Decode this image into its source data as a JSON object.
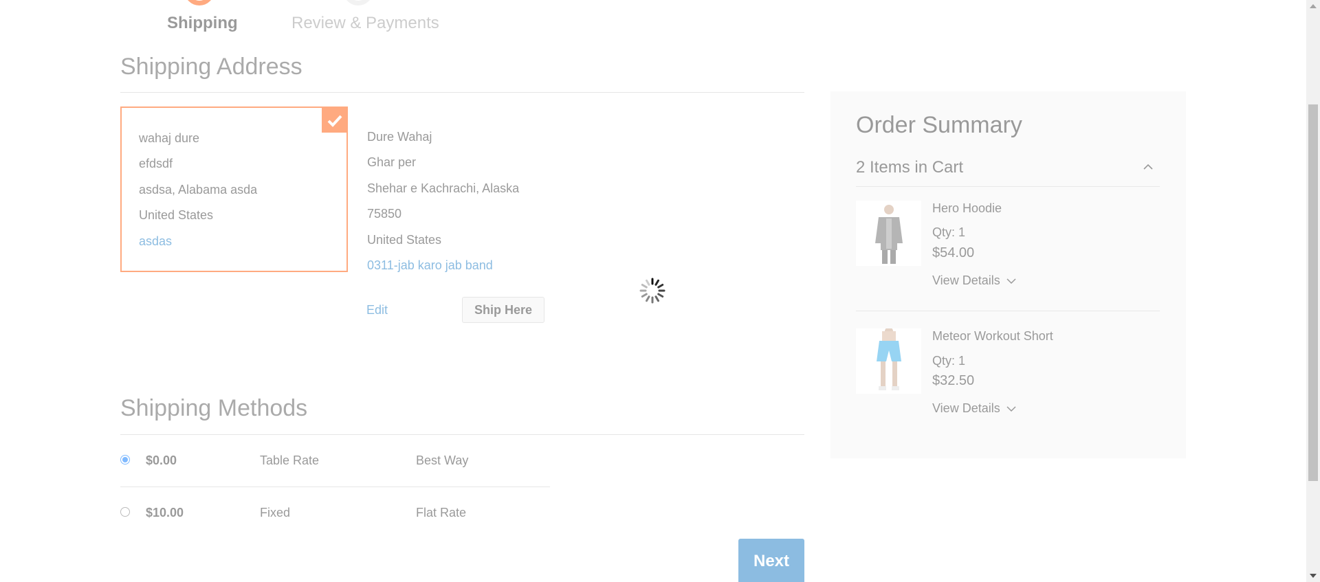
{
  "progress": {
    "steps": [
      {
        "label": "Shipping",
        "active": true
      },
      {
        "label": "Review & Payments",
        "active": false
      }
    ]
  },
  "shipping_address": {
    "title": "Shipping Address",
    "selected_address": {
      "lines": [
        "wahaj dure",
        "efdsdf",
        "asdsa, Alabama asda",
        "United States"
      ],
      "phone": "asdas"
    },
    "other_address": {
      "lines": [
        "Dure Wahaj",
        "Ghar per",
        "Shehar e Kachrachi, Alaska",
        "75850",
        "United States"
      ],
      "phone": "0311-jab karo jab band",
      "edit_label": "Edit",
      "ship_here_label": "Ship Here"
    }
  },
  "shipping_methods": {
    "title": "Shipping Methods",
    "rows": [
      {
        "price": "$0.00",
        "method": "Table Rate",
        "carrier": "Best Way",
        "selected": true
      },
      {
        "price": "$10.00",
        "method": "Fixed",
        "carrier": "Flat Rate",
        "selected": false
      }
    ],
    "next_label": "Next"
  },
  "order_summary": {
    "title": "Order Summary",
    "cart_count": "2 Items in Cart",
    "items": [
      {
        "name": "Hero Hoodie",
        "qty": "Qty: 1",
        "price": "$54.00",
        "details_label": "View Details",
        "thumb_icon": "hoodie-product-image"
      },
      {
        "name": "Meteor Workout Short",
        "qty": "Qty: 1",
        "price": "$32.50",
        "details_label": "View Details",
        "thumb_icon": "shorts-product-image"
      }
    ]
  },
  "colors": {
    "accent": "#ff5501",
    "link": "#1979c3",
    "primary_button": "#1979c3"
  }
}
